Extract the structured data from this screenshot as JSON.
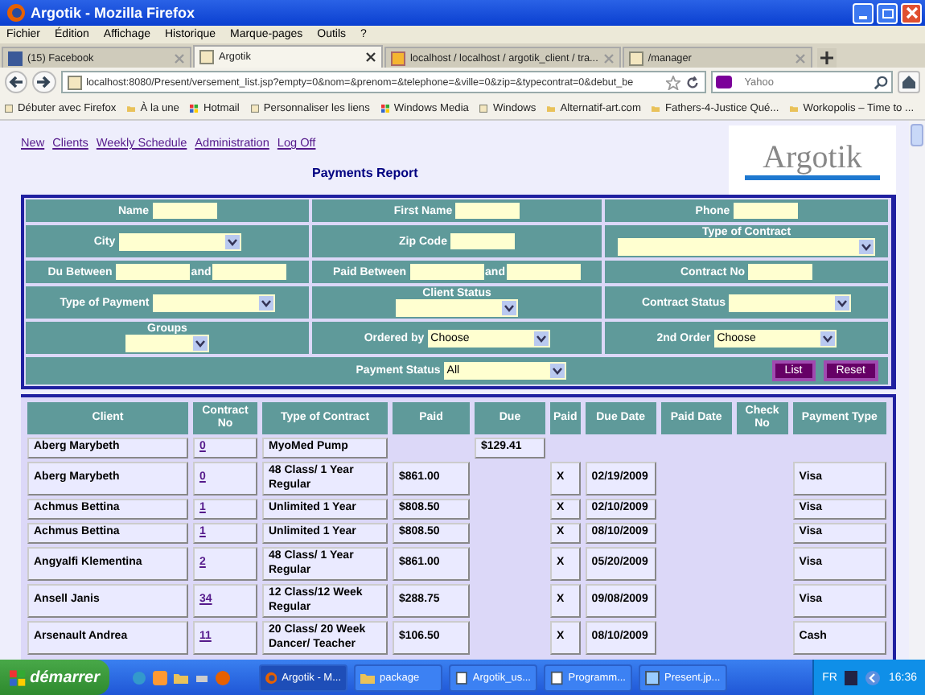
{
  "window": {
    "title": "Argotik - Mozilla Firefox"
  },
  "menu": [
    "Fichier",
    "Édition",
    "Affichage",
    "Historique",
    "Marque-pages",
    "Outils",
    "?"
  ],
  "tabs": [
    {
      "label": "(15) Facebook",
      "selected": false,
      "kind": "facebook"
    },
    {
      "label": "Argotik",
      "selected": true,
      "kind": "page"
    },
    {
      "label": "localhost / localhost / argotik_client / tra...",
      "selected": false,
      "kind": "db"
    },
    {
      "label": "/manager",
      "selected": false,
      "kind": "page"
    }
  ],
  "address": {
    "value": "localhost:8080/Present/versement_list.jsp?empty=0&nom=&prenom=&telephone=&ville=0&zip=&typecontrat=0&debut_be"
  },
  "search": {
    "placeholder": "Yahoo"
  },
  "bookmarks": [
    {
      "label": "Débuter avec Firefox",
      "kind": "page"
    },
    {
      "label": "À la une",
      "kind": "folder"
    },
    {
      "label": "Hotmail",
      "kind": "windows"
    },
    {
      "label": "Personnaliser les liens",
      "kind": "page"
    },
    {
      "label": "Windows Media",
      "kind": "windows"
    },
    {
      "label": "Windows",
      "kind": "page"
    },
    {
      "label": "Alternatif-art.com",
      "kind": "folder"
    },
    {
      "label": "Fathers-4-Justice Qué...",
      "kind": "folder"
    },
    {
      "label": "Workopolis – Time to ...",
      "kind": "folder"
    }
  ],
  "nav_links": [
    "New",
    "Clients",
    "Weekly Schedule",
    "Administration",
    "Log Off"
  ],
  "logo": "Argotik",
  "page_title": "Payments Report",
  "filters": [
    [
      {
        "label": "Name",
        "stacked": false,
        "fields": [
          {
            "kind": "text"
          }
        ]
      },
      {
        "label": "First Name",
        "stacked": false,
        "fields": [
          {
            "kind": "text"
          }
        ]
      },
      {
        "label": "Phone",
        "stacked": false,
        "fields": [
          {
            "kind": "text"
          }
        ]
      }
    ],
    [
      {
        "label": "City",
        "stacked": false,
        "fields": [
          {
            "kind": "select"
          }
        ]
      },
      {
        "label": "Zip Code",
        "stacked": false,
        "fields": [
          {
            "kind": "text"
          }
        ]
      },
      {
        "label": "Type of Contract",
        "stacked": true,
        "fields": [
          {
            "kind": "wide-select"
          }
        ]
      }
    ],
    [
      {
        "label": "Du Between",
        "stacked": false,
        "fields": [
          {
            "kind": "text"
          },
          {
            "kind": "word",
            "text": "and"
          },
          {
            "kind": "text"
          }
        ]
      },
      {
        "label": "Paid Between",
        "stacked": false,
        "fields": [
          {
            "kind": "text"
          },
          {
            "kind": "word",
            "text": "and"
          },
          {
            "kind": "text"
          }
        ]
      },
      {
        "label": "Contract No",
        "stacked": false,
        "fields": [
          {
            "kind": "text"
          }
        ]
      }
    ],
    [
      {
        "label": "Type of Payment",
        "stacked": false,
        "fields": [
          {
            "kind": "select"
          }
        ]
      },
      {
        "label": "Client Status",
        "stacked": true,
        "fields": [
          {
            "kind": "select"
          }
        ]
      },
      {
        "label": "Contract Status",
        "stacked": false,
        "fields": [
          {
            "kind": "select"
          }
        ]
      }
    ],
    [
      {
        "label": "Groups",
        "stacked": true,
        "fields": [
          {
            "kind": "small-select"
          }
        ]
      },
      {
        "label": "Ordered by",
        "stacked": false,
        "fields": [
          {
            "kind": "select",
            "value": "Choose"
          }
        ]
      },
      {
        "label": "2nd Order",
        "stacked": false,
        "fields": [
          {
            "kind": "select",
            "value": "Choose"
          }
        ]
      }
    ]
  ],
  "payment_status": {
    "label": "Payment Status",
    "value": "All"
  },
  "buttons": [
    "List",
    "Reset"
  ],
  "table": {
    "columns": [
      "Client",
      "Contract No",
      "Type of Contract",
      "Paid",
      "Due",
      "Paid",
      "Due Date",
      "Paid Date",
      "Check No",
      "Payment Type"
    ],
    "rows": [
      {
        "client": "Aberg Marybeth",
        "contract_no": "0",
        "type": "MyoMed Pump",
        "due": "$129.41"
      },
      {
        "client": "Aberg Marybeth",
        "contract_no": "0",
        "type": "48 Class/ 1 Year Regular",
        "paid": "$861.00",
        "paid_flag": "X",
        "due_date": "02/19/2009",
        "payment_type": "Visa"
      },
      {
        "client": "Achmus Bettina",
        "contract_no": "1",
        "type": "Unlimited 1 Year",
        "paid": "$808.50",
        "paid_flag": "X",
        "due_date": "02/10/2009",
        "payment_type": "Visa"
      },
      {
        "client": "Achmus Bettina",
        "contract_no": "1",
        "type": "Unlimited 1 Year",
        "paid": "$808.50",
        "paid_flag": "X",
        "due_date": "08/10/2009",
        "payment_type": "Visa"
      },
      {
        "client": "Angyalfi Klementina",
        "contract_no": "2",
        "type": "48 Class/ 1 Year Regular",
        "paid": "$861.00",
        "paid_flag": "X",
        "due_date": "05/20/2009",
        "payment_type": "Visa"
      },
      {
        "client": "Ansell Janis",
        "contract_no": "34",
        "type": "12 Class/12 Week Regular",
        "paid": "$288.75",
        "paid_flag": "X",
        "due_date": "09/08/2009",
        "payment_type": "Visa"
      },
      {
        "client": "Arsenault Andrea",
        "contract_no": "11",
        "type": "20 Class/ 20 Week Dancer/ Teacher",
        "paid": "$106.50",
        "paid_flag": "X",
        "due_date": "08/10/2009",
        "payment_type": "Cash"
      }
    ]
  },
  "taskbar": {
    "start": "démarrer",
    "tasks": [
      {
        "label": "Argotik - M...",
        "kind": "firefox",
        "selected": true
      },
      {
        "label": "package",
        "kind": "folder",
        "selected": false
      },
      {
        "label": "Argotik_us...",
        "kind": "doc",
        "selected": false
      },
      {
        "label": "Programm...",
        "kind": "doc",
        "selected": false
      },
      {
        "label": "Present.jp...",
        "kind": "image",
        "selected": false
      }
    ],
    "language": "FR",
    "clock": "16:36"
  }
}
